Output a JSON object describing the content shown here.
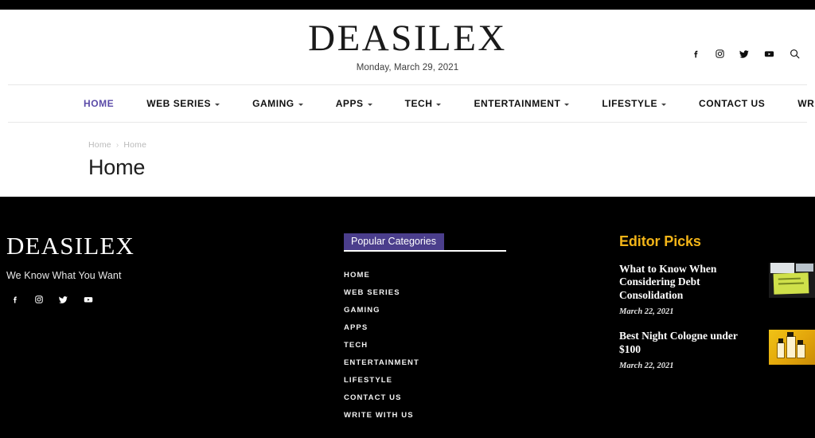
{
  "topbar": {
    "present": true
  },
  "header": {
    "brand": "DEASILEX",
    "date": "Monday, March 29, 2021",
    "social": [
      {
        "name": "facebook-icon",
        "label": "Facebook"
      },
      {
        "name": "instagram-icon",
        "label": "Instagram"
      },
      {
        "name": "twitter-icon",
        "label": "Twitter"
      },
      {
        "name": "youtube-icon",
        "label": "YouTube"
      },
      {
        "name": "search-icon",
        "label": "Search"
      }
    ]
  },
  "nav": {
    "active_color": "#5b4ba8",
    "items": [
      {
        "label": "HOME",
        "has_dropdown": false,
        "active": true
      },
      {
        "label": "WEB SERIES",
        "has_dropdown": true,
        "active": false
      },
      {
        "label": "GAMING",
        "has_dropdown": true,
        "active": false
      },
      {
        "label": "APPS",
        "has_dropdown": true,
        "active": false
      },
      {
        "label": "TECH",
        "has_dropdown": true,
        "active": false
      },
      {
        "label": "ENTERTAINMENT",
        "has_dropdown": true,
        "active": false
      },
      {
        "label": "LIFESTYLE",
        "has_dropdown": true,
        "active": false
      },
      {
        "label": "CONTACT US",
        "has_dropdown": false,
        "active": false
      },
      {
        "label": "WRITE WITH US",
        "has_dropdown": false,
        "active": false
      }
    ]
  },
  "page": {
    "breadcrumb": [
      "Home",
      "Home"
    ],
    "breadcrumb_separator": "›",
    "title": "Home"
  },
  "footer": {
    "brand": "DEASILEX",
    "tagline": "We Know What You Want",
    "social": [
      {
        "name": "facebook-icon",
        "label": "Facebook"
      },
      {
        "name": "instagram-icon",
        "label": "Instagram"
      },
      {
        "name": "twitter-icon",
        "label": "Twitter"
      },
      {
        "name": "youtube-icon",
        "label": "YouTube"
      }
    ],
    "categories": {
      "heading": "Popular Categories",
      "heading_bg": "#4b3e8c",
      "items": [
        "HOME",
        "WEB SERIES",
        "GAMING",
        "APPS",
        "TECH",
        "ENTERTAINMENT",
        "LIFESTYLE",
        "CONTACT US",
        "WRITE WITH US"
      ]
    },
    "editor_picks": {
      "heading": "Editor Picks",
      "heading_color": "#f2b418",
      "items": [
        {
          "title": "What to Know When Considering Debt Consolidation",
          "date": "March 22, 2021",
          "thumb": "debt-consolidation-sticky-note-thumbnail"
        },
        {
          "title": "Best Night Cologne under $100",
          "date": "March 22, 2021",
          "thumb": "cologne-bottles-thumbnail"
        }
      ]
    }
  }
}
